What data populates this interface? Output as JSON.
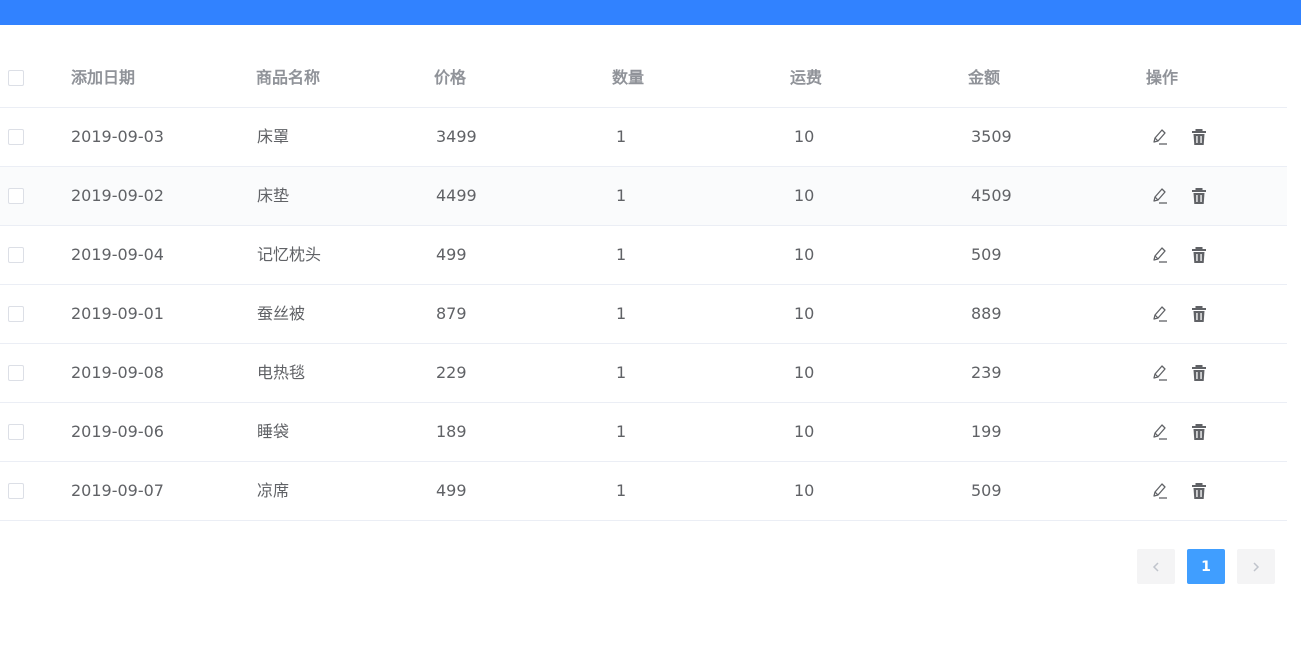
{
  "header": {
    "date": "添加日期",
    "name": "商品名称",
    "price": "价格",
    "qty": "数量",
    "shipping": "运费",
    "total": "金额",
    "ops": "操作"
  },
  "rows": [
    {
      "date": "2019-09-03",
      "name": "床罩",
      "price": "3499",
      "qty": "1",
      "shipping": "10",
      "total": "3509"
    },
    {
      "date": "2019-09-02",
      "name": "床垫",
      "price": "4499",
      "qty": "1",
      "shipping": "10",
      "total": "4509"
    },
    {
      "date": "2019-09-04",
      "name": "记忆枕头",
      "price": "499",
      "qty": "1",
      "shipping": "10",
      "total": "509"
    },
    {
      "date": "2019-09-01",
      "name": "蚕丝被",
      "price": "879",
      "qty": "1",
      "shipping": "10",
      "total": "889"
    },
    {
      "date": "2019-09-08",
      "name": "电热毯",
      "price": "229",
      "qty": "1",
      "shipping": "10",
      "total": "239"
    },
    {
      "date": "2019-09-06",
      "name": "睡袋",
      "price": "189",
      "qty": "1",
      "shipping": "10",
      "total": "199"
    },
    {
      "date": "2019-09-07",
      "name": "凉席",
      "price": "499",
      "qty": "1",
      "shipping": "10",
      "total": "509"
    }
  ],
  "pagination": {
    "current": "1",
    "prev_icon": "chevron-left-icon",
    "next_icon": "chevron-right-icon"
  },
  "icons": {
    "edit": "edit-icon",
    "delete": "delete-icon"
  },
  "colors": {
    "topbar": "#3182ff",
    "page_active": "#409eff",
    "delete_icon": "#606266"
  }
}
